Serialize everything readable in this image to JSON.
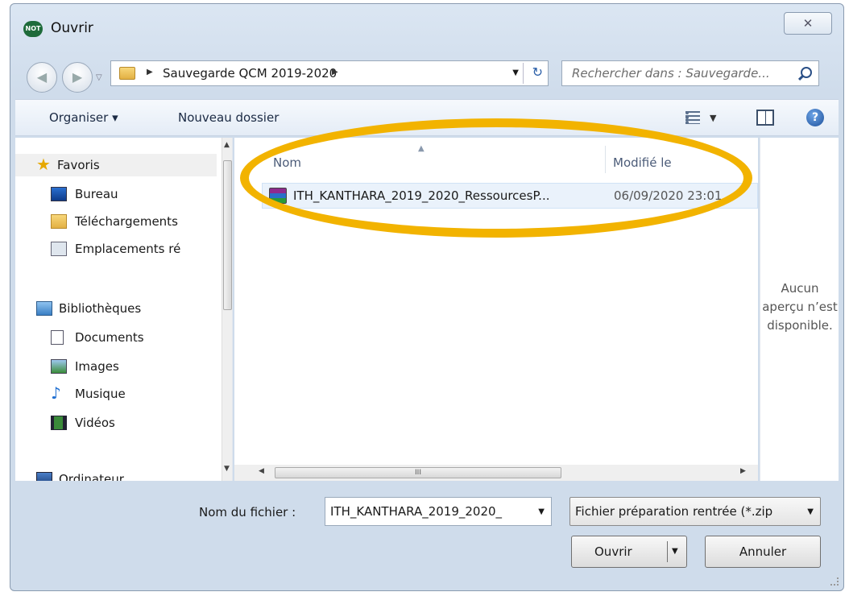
{
  "window": {
    "app_badge": "NOT",
    "title": "Ouvrir",
    "close_glyph": "✕"
  },
  "address": {
    "path": "Sauvegarde QCM 2019-2020",
    "crumb_arrow": "▶",
    "refresh_glyph": "↻"
  },
  "search": {
    "placeholder": "Rechercher dans : Sauvegarde..."
  },
  "toolbar": {
    "organise_label": "Organiser ▾",
    "new_folder_label": "Nouveau dossier",
    "views_dropdown": "▼"
  },
  "help": {
    "glyph": "?"
  },
  "nav": {
    "items": [
      {
        "label": "Favoris",
        "icon": "star-icon"
      },
      {
        "label": "Bureau",
        "icon": "desktop-icon"
      },
      {
        "label": "Téléchargements",
        "icon": "downloads-folder-icon"
      },
      {
        "label": "Emplacements ré",
        "icon": "recent-places-icon"
      },
      {
        "label": "Bibliothèques",
        "icon": "libraries-icon"
      },
      {
        "label": "Documents",
        "icon": "documents-icon"
      },
      {
        "label": "Images",
        "icon": "images-icon"
      },
      {
        "label": "Musique",
        "icon": "music-icon"
      },
      {
        "label": "Vidéos",
        "icon": "videos-icon"
      },
      {
        "label": "Ordinateur",
        "icon": "computer-icon"
      }
    ]
  },
  "files": {
    "col_name": "Nom",
    "col_date": "Modifié le",
    "rows": [
      {
        "name": "ITH_KANTHARA_2019_2020_RessourcesP...",
        "date": "06/09/2020 23:01",
        "icon": "winrar-archive-icon"
      }
    ],
    "hscroll_grip": "III"
  },
  "preview": {
    "message": "Aucun aperçu n’est disponible."
  },
  "bottom": {
    "filename_label": "Nom du fichier :",
    "filename_value": "ITH_KANTHARA_2019_2020_",
    "filter_value": "Fichier préparation rentrée (*.zip",
    "open_label": "Ouvrir",
    "cancel_label": "Annuler",
    "dropdown_glyph": "▼"
  },
  "colors": {
    "highlight": "#f2b300",
    "selection": "#eaf2fb"
  }
}
